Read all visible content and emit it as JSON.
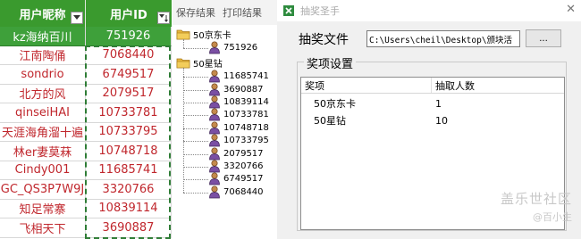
{
  "sheet": {
    "header": {
      "col1": "用户昵称",
      "col2": "用户ID"
    },
    "rows": [
      {
        "name": "kz海纳百川",
        "id": "751926"
      },
      {
        "name": "江南陶俑",
        "id": "7068440"
      },
      {
        "name": "sondrio",
        "id": "6749517"
      },
      {
        "name": "北方的风",
        "id": "2079517"
      },
      {
        "name": "qinseiHAI",
        "id": "10733781"
      },
      {
        "name": "天涯海角溜十遍",
        "id": "10733795"
      },
      {
        "name": "林er妻莫菻",
        "id": "10748718"
      },
      {
        "name": "Cindy001",
        "id": "11685741"
      },
      {
        "name": "GC_QS3P7W9J",
        "id": "3320766"
      },
      {
        "name": "知足常寨",
        "id": "10839114"
      },
      {
        "name": "飞相天下",
        "id": "3690887"
      }
    ]
  },
  "toolbar": {
    "save_label": "保存结果",
    "print_label": "打印结果"
  },
  "tree": {
    "groups": [
      {
        "label": "50京东卡",
        "items": [
          "751926"
        ]
      },
      {
        "label": "50星钻",
        "items": [
          "11685741",
          "3690887",
          "10839114",
          "10733781",
          "10748718",
          "10733795",
          "2079517",
          "3320766",
          "6749517",
          "7068440"
        ]
      }
    ]
  },
  "dialog": {
    "title": "抽奖圣手",
    "file_label": "抽奖文件",
    "file_path": "C:\\Users\\cheil\\Desktop\\颁块活",
    "browse_label": "...",
    "group_title": "奖项设置",
    "columns": [
      "奖项",
      "抽取人数"
    ],
    "prizes": [
      {
        "name": "50京东卡",
        "count": "1"
      },
      {
        "name": "50星钻",
        "count": "10"
      }
    ]
  },
  "watermark": {
    "line1": "盖乐世社区",
    "line2": "@百小生"
  },
  "colors": {
    "header_green": "#3a9a2e",
    "cell_red": "#c0272d"
  }
}
